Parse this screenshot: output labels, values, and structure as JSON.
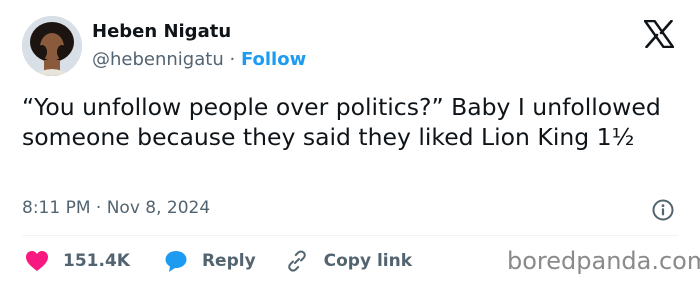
{
  "author": {
    "name": "Heben Nigatu",
    "handle": "@hebennigatu",
    "separator": "·",
    "follow_label": "Follow",
    "avatar_icon": "profile-photo"
  },
  "brand_icon": "x-logo-icon",
  "tweet": {
    "text": "“You unfollow people over politics?” Baby I unfollowed someone because they said they liked Lion King 1½",
    "timestamp": "8:11 PM · Nov 8, 2024",
    "info_icon": "info-icon"
  },
  "actions": {
    "like": {
      "icon": "heart-icon",
      "label": "151.4K"
    },
    "reply": {
      "icon": "speech-bubble-icon",
      "label": "Reply"
    },
    "copy_link": {
      "icon": "link-icon",
      "label": "Copy link"
    }
  },
  "watermark": "boredpanda.com",
  "colors": {
    "follow_blue": "#1d9bf0",
    "heart_pink": "#f91880",
    "reply_blue": "#1d9bf0",
    "text": "#0f1419",
    "secondary_text": "#536471"
  }
}
